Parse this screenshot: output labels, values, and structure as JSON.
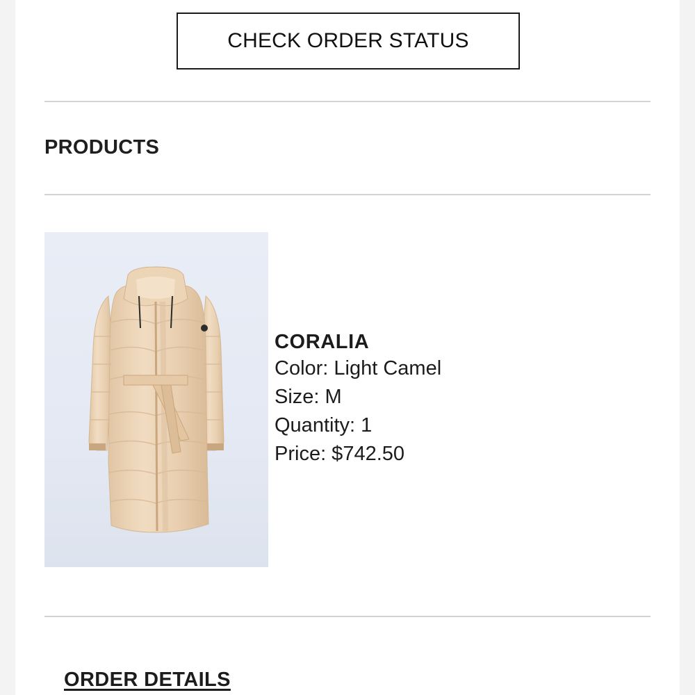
{
  "header": {
    "check_status_label": "CHECK ORDER STATUS"
  },
  "products_section": {
    "title": "PRODUCTS",
    "items": [
      {
        "name": "CORALIA",
        "color": "Color: Light Camel",
        "size": "Size: M",
        "quantity": "Quantity: 1",
        "price": "Price: $742.50",
        "image_icon": "down-coat-image",
        "image_colors": {
          "coat": "#ebd3b6",
          "background": "#e6ebf4"
        }
      }
    ]
  },
  "order_details": {
    "label": "ORDER DETAILS"
  }
}
